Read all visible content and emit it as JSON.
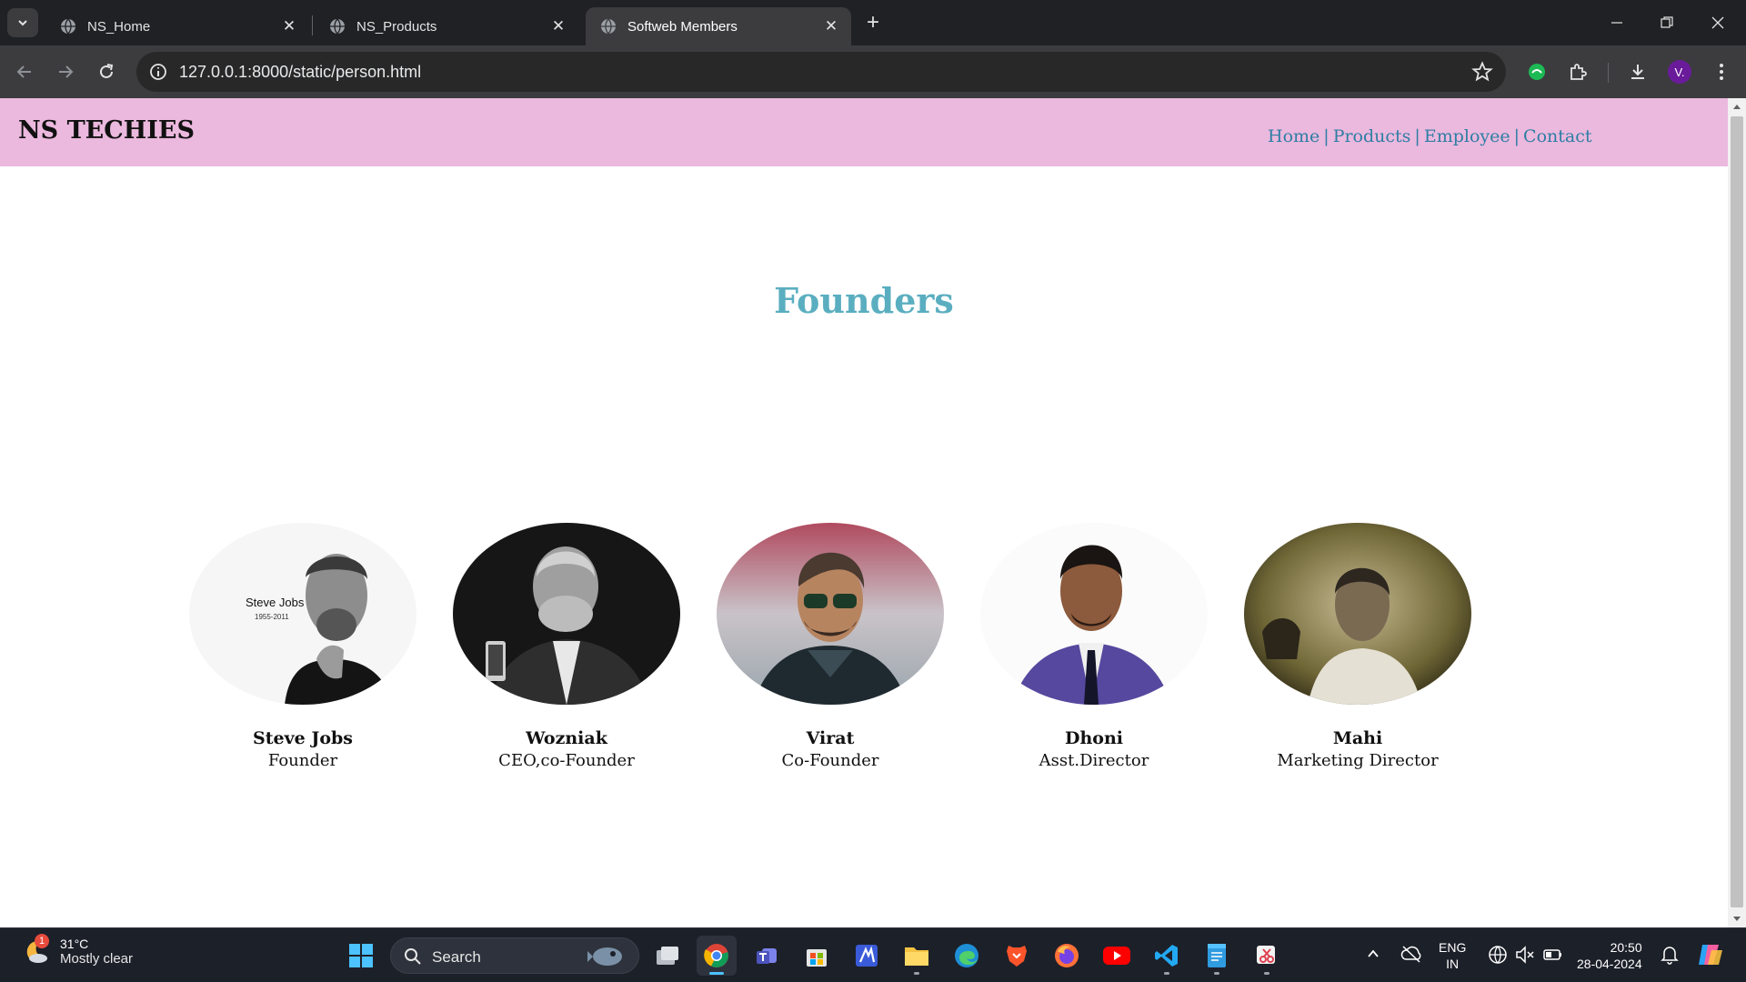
{
  "browser": {
    "tabs": [
      {
        "title": "NS_Home",
        "active": false
      },
      {
        "title": "NS_Products",
        "active": false
      },
      {
        "title": "Softweb Members",
        "active": true
      }
    ],
    "url": "127.0.0.1:8000/static/person.html",
    "profile_initial": "V."
  },
  "site": {
    "brand": "NS TECHIES",
    "nav": [
      "Home",
      "Products",
      "Employee",
      "Contact"
    ],
    "nav_separator": "|",
    "section_title": "Founders",
    "members": [
      {
        "name": "Steve Jobs",
        "role": "Founder",
        "photo_caption": "Steve Jobs",
        "photo_years": "1955-2011"
      },
      {
        "name": "Wozniak",
        "role": "CEO,co-Founder"
      },
      {
        "name": "Virat",
        "role": "Co-Founder"
      },
      {
        "name": "Dhoni",
        "role": "Asst.Director"
      },
      {
        "name": "Mahi",
        "role": "Marketing Director"
      }
    ]
  },
  "taskbar": {
    "weather": {
      "temp": "31°C",
      "desc": "Mostly clear",
      "badge": "1"
    },
    "search_label": "Search",
    "apps": [
      "file-explorer-icon",
      "chrome-icon",
      "teams-icon",
      "store-icon",
      "app-icon",
      "folder-icon",
      "edge-icon",
      "brave-icon",
      "firefox-icon",
      "youtube-icon",
      "vscode-icon",
      "notepad-icon",
      "snipping-tool-icon"
    ],
    "lang": "ENG",
    "region": "IN",
    "time": "20:50",
    "date": "28-04-2024"
  },
  "colors": {
    "header_bg": "#ebb8de",
    "nav_link": "#2e7ea3",
    "section_title": "#5aaec0"
  }
}
